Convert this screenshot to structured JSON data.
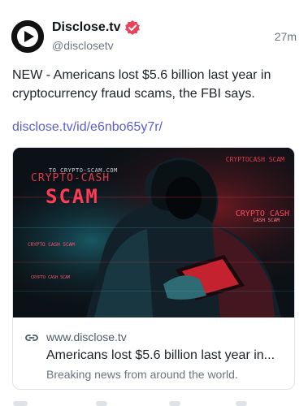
{
  "post": {
    "author_name": "Disclose.tv",
    "handle": "@disclosetv",
    "time": "27m",
    "text": "NEW - Americans lost $5.6 billion last year in cryptocurrency fraud scams, the FBI says.",
    "link": "disclose.tv/id/e6nbo65y7r/"
  },
  "card": {
    "image_text": {
      "small": "TO CRYPTO-SCAM.COM",
      "crypto": "CRYPTO-CASH",
      "scam": "SCAM",
      "right1": "CRYPTOCASH SCAM",
      "right2": "CRYPTO CASH",
      "right3": "CASH SCAM",
      "left1": "CRYPTO CASH SCAM",
      "left2": "CRYPTO CASH SCAM"
    },
    "domain": "www.disclose.tv",
    "title": "Americans lost $5.6 billion last year in...",
    "description": "Breaking news from around the world."
  },
  "colors": {
    "link": "#5a5fd0",
    "verified": "#e8435b",
    "scam_red": "#ff3b55"
  },
  "icons": {
    "avatar": "play-logo-icon",
    "verified": "verified-badge-icon",
    "link": "link-icon"
  }
}
